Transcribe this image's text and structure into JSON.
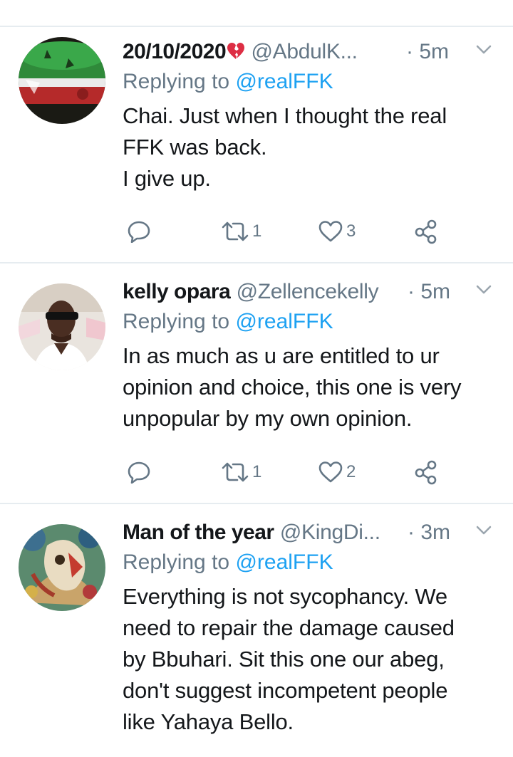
{
  "replying_prefix": "Replying to",
  "replying_handle": "@realFFK",
  "tweets": [
    {
      "name": "20/10/2020",
      "name_emoji": "broken-heart-icon",
      "handle": "@AbdulK...",
      "time": "· 5m",
      "body": "Chai. Just when I thought the real\nFFK was back.\nI give up.",
      "retweets": "1",
      "likes": "3"
    },
    {
      "name": "kelly opara",
      "handle": "@Zellencekelly",
      "time": "· 5m",
      "body": "In as much as u are entitled to ur\nopinion and choice, this one is very\nunpopular by my  own opinion.",
      "retweets": "1",
      "likes": "2"
    },
    {
      "name": "Man of the year",
      "handle": "@KingDi...",
      "time": "· 3m",
      "body": "Everything is not sycophancy. We\nneed to repair the damage caused\nby Bbuhari. Sit this one our abeg,\ndon't suggest incompetent people\nlike Yahaya Bello."
    }
  ],
  "colors": {
    "text": "#14171a",
    "secondary": "#657786",
    "link": "#1da1f2",
    "divider": "#e6ecf0"
  }
}
